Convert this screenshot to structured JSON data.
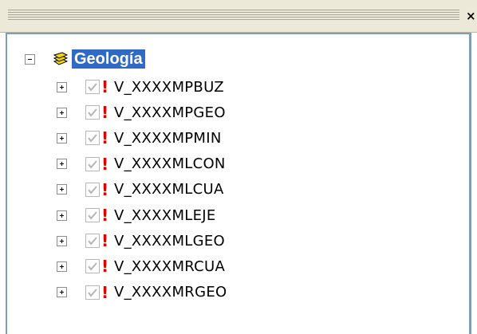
{
  "window": {
    "close_glyph": "×"
  },
  "tree": {
    "root": {
      "label": "Geología",
      "icon": "layers-icon",
      "expanded": true,
      "selected": true
    },
    "layers": [
      {
        "name": "V_XXXXMPBUZ",
        "checked": true,
        "warning": "!"
      },
      {
        "name": "V_XXXXMPGEO",
        "checked": true,
        "warning": "!"
      },
      {
        "name": "V_XXXXMPMIN",
        "checked": true,
        "warning": "!"
      },
      {
        "name": "V_XXXXMLCON",
        "checked": true,
        "warning": "!"
      },
      {
        "name": "V_XXXXMLCUA",
        "checked": true,
        "warning": "!"
      },
      {
        "name": "V_XXXXMLEJE",
        "checked": true,
        "warning": "!"
      },
      {
        "name": "V_XXXXMLGEO",
        "checked": true,
        "warning": "!"
      },
      {
        "name": "V_XXXXMRCUA",
        "checked": true,
        "warning": "!"
      },
      {
        "name": "V_XXXXMRGEO",
        "checked": true,
        "warning": "!"
      }
    ]
  },
  "colors": {
    "selection": "#316ac5",
    "warning": "#e00000",
    "border": "#7f9db9"
  }
}
